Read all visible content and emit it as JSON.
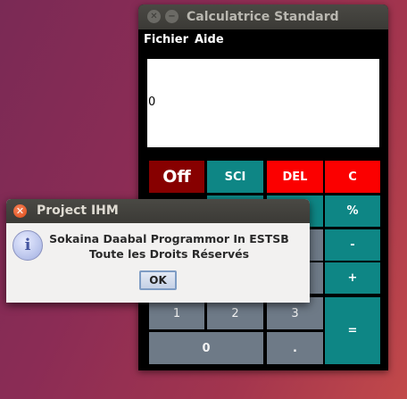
{
  "calculator": {
    "title": "Calculatrice Standard",
    "menu": {
      "file": "Fichier",
      "help": "Aide"
    },
    "display_value": "0",
    "keys": {
      "off": "Off",
      "sci": "SCI",
      "del": "DEL",
      "clear": "C",
      "percent": "%",
      "minus": "-",
      "plus": "+",
      "one": "1",
      "two": "2",
      "three": "3",
      "zero": "0",
      "dot": ".",
      "equals": "="
    }
  },
  "dialog": {
    "title": "Project IHM",
    "line1": "Sokaina Daabal Programmor In ESTSB",
    "line2": "Toute les Droits Réservés",
    "ok_label": "OK",
    "icon": "info-icon"
  },
  "colors": {
    "teal": "#0e8685",
    "red": "#fb0000",
    "dark_red": "#870000",
    "gray": "#6e7a87"
  }
}
